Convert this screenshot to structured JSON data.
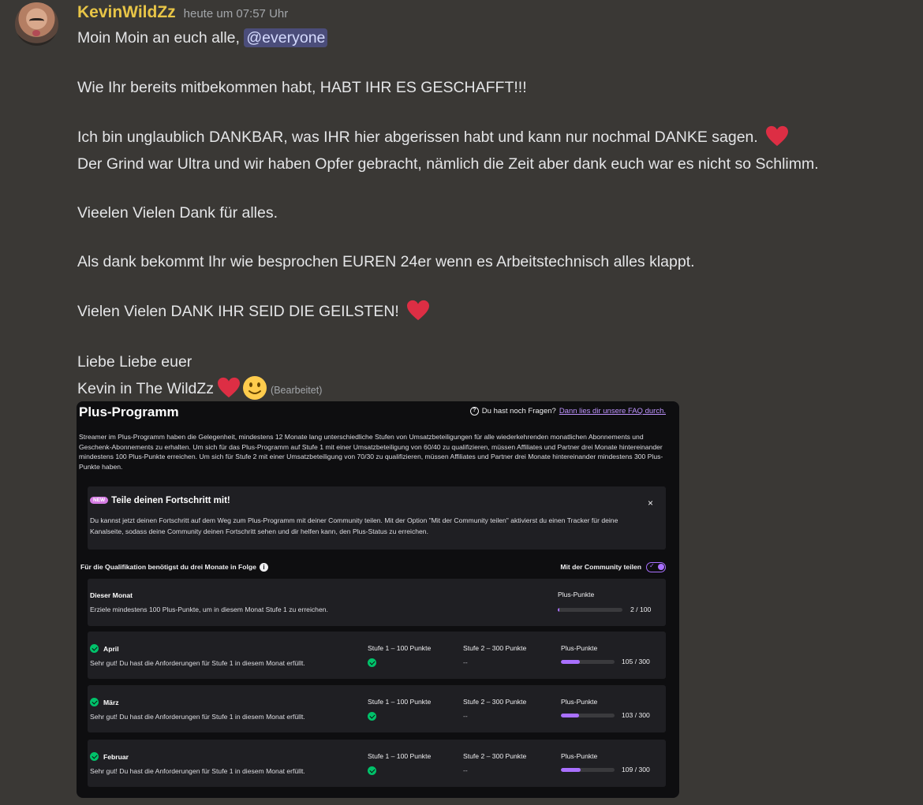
{
  "message": {
    "author": "KevinWildZz",
    "timestamp": "heute um 07:57 Uhr",
    "line1_text": "Moin Moin an euch alle, ",
    "mention": "@everyone",
    "line2": "Wie Ihr bereits mitbekommen habt, HABT IHR ES GESCHAFFT!!!",
    "line3": "Ich bin unglaublich DANKBAR, was IHR hier abgerissen habt und kann nur nochmal DANKE sagen.",
    "line4": "Der Grind war Ultra und wir haben Opfer gebracht, nämlich die Zeit aber dank euch war es nicht so Schlimm.",
    "line5": "Vieelen Vielen Dank für alles.",
    "line6": "Als dank bekommt Ihr wie besprochen EUREN 24er wenn es Arbeitstechnisch alles klappt.",
    "line7": "Vielen Vielen DANK IHR SEID DIE GEILSTEN!",
    "line8": "Liebe Liebe euer",
    "line9": "Kevin in The WildZz",
    "edited": "(Bearbeitet)",
    "emojis": [
      "heart-emoji",
      "smiley-emoji"
    ],
    "colors": {
      "username": "#e8c547",
      "mention_bg": "#4b4d7a",
      "heart": "#dd2e44"
    }
  },
  "embed": {
    "title": "Plus-Programm",
    "faq_question": "Du hast noch Fragen?",
    "faq_link": "Dann lies dir unsere FAQ durch.",
    "intro": "Streamer im Plus-Programm haben die Gelegenheit, mindestens 12 Monate lang unterschiedliche Stufen von Umsatzbeteiligungen für alle wiederkehrenden monatlichen Abonnements und Geschenk-Abonnements zu erhalten. Um sich für das Plus-Programm auf Stufe 1 mit einer Umsatzbeteiligung von 60/40 zu qualifizieren, müssen Affiliates und Partner drei Monate hintereinander mindestens 100 Plus-Punkte erreichen. Um sich für Stufe 2 mit einer Umsatzbeteiligung von 70/30 zu qualifizieren, müssen Affiliates und Partner drei Monate hintereinander mindestens 300 Plus-Punkte haben.",
    "share": {
      "badge": "NEW",
      "title": "Teile deinen Fortschritt mit!",
      "close": "×",
      "text": "Du kannst jetzt deinen Fortschritt auf dem Weg zum Plus-Programm mit deiner Community teilen. Mit der Option \"Mit der Community teilen\" aktivierst du einen Tracker für deine Kanalseite, sodass deine Community deinen Fortschritt sehen und dir helfen kann, den Plus-Status zu erreichen."
    },
    "qualification_label": "Für die Qualifikation benötigst du drei Monate in Folge",
    "share_toggle_label": "Mit der Community teilen",
    "share_toggle_on": true,
    "current_month": {
      "label": "Dieser Monat",
      "text": "Erziele mindestens 100 Plus-Punkte, um in diesem Monat Stufe 1 zu erreichen.",
      "points_label": "Plus-Punkte",
      "points": "2 / 100",
      "progress": 0.02
    },
    "months": [
      {
        "name": "April",
        "text": "Sehr gut! Du hast die Anforderungen für Stufe 1 in diesem Monat erfüllt.",
        "tier1_label": "Stufe 1 – 100 Punkte",
        "tier2_label": "Stufe 2 – 300 Punkte",
        "tier2_value": "--",
        "points_label": "Plus-Punkte",
        "points": "105 / 300",
        "progress": 0.35
      },
      {
        "name": "März",
        "text": "Sehr gut! Du hast die Anforderungen für Stufe 1 in diesem Monat erfüllt.",
        "tier1_label": "Stufe 1 – 100 Punkte",
        "tier2_label": "Stufe 2 – 300 Punkte",
        "tier2_value": "--",
        "points_label": "Plus-Punkte",
        "points": "103 / 300",
        "progress": 0.343
      },
      {
        "name": "Februar",
        "text": "Sehr gut! Du hast die Anforderungen für Stufe 1 in diesem Monat erfüllt.",
        "tier1_label": "Stufe 1 – 100 Punkte",
        "tier2_label": "Stufe 2 – 300 Punkte",
        "tier2_value": "--",
        "points_label": "Plus-Punkte",
        "points": "109 / 300",
        "progress": 0.363
      }
    ]
  }
}
